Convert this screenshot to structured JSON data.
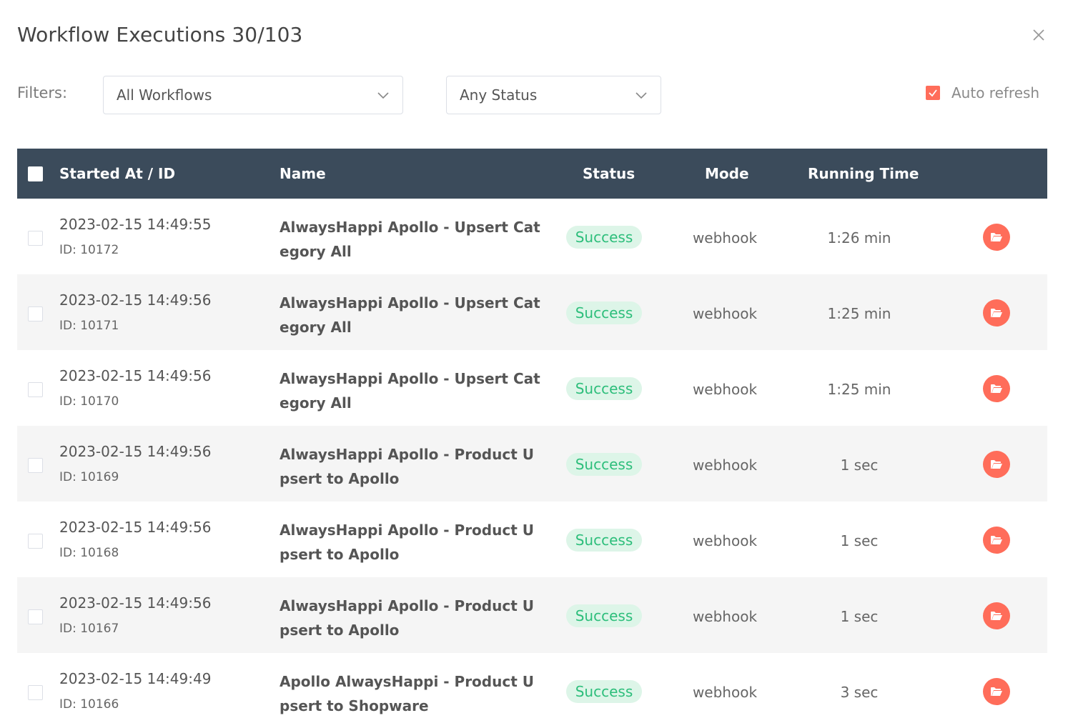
{
  "dialog": {
    "title": "Workflow Executions 30/103",
    "close_icon": "close-icon"
  },
  "filters": {
    "label": "Filters:",
    "workflow_select": "All Workflows",
    "status_select": "Any Status",
    "auto_refresh_label": "Auto refresh",
    "auto_refresh_checked": true
  },
  "table": {
    "headers": {
      "started": "Started At / ID",
      "name": "Name",
      "status": "Status",
      "mode": "Mode",
      "running_time": "Running Time"
    },
    "rows": [
      {
        "started": "2023-02-15 14:49:55",
        "id": "ID: 10172",
        "name": "AlwaysHappi Apollo - Upsert Category All",
        "status": "Success",
        "mode": "webhook",
        "running_time": "1:26 min"
      },
      {
        "started": "2023-02-15 14:49:56",
        "id": "ID: 10171",
        "name": "AlwaysHappi Apollo - Upsert Category All",
        "status": "Success",
        "mode": "webhook",
        "running_time": "1:25 min"
      },
      {
        "started": "2023-02-15 14:49:56",
        "id": "ID: 10170",
        "name": "AlwaysHappi Apollo - Upsert Category All",
        "status": "Success",
        "mode": "webhook",
        "running_time": "1:25 min"
      },
      {
        "started": "2023-02-15 14:49:56",
        "id": "ID: 10169",
        "name": "AlwaysHappi Apollo - Product Upsert to Apollo",
        "status": "Success",
        "mode": "webhook",
        "running_time": "1 sec"
      },
      {
        "started": "2023-02-15 14:49:56",
        "id": "ID: 10168",
        "name": "AlwaysHappi Apollo - Product Upsert to Apollo",
        "status": "Success",
        "mode": "webhook",
        "running_time": "1 sec"
      },
      {
        "started": "2023-02-15 14:49:56",
        "id": "ID: 10167",
        "name": "AlwaysHappi Apollo - Product Upsert to Apollo",
        "status": "Success",
        "mode": "webhook",
        "running_time": "1 sec"
      },
      {
        "started": "2023-02-15 14:49:49",
        "id": "ID: 10166",
        "name": "Apollo AlwaysHappi - Product Upsert to Shopware",
        "status": "Success",
        "mode": "webhook",
        "running_time": "3 sec"
      }
    ]
  },
  "colors": {
    "accent": "#ff6d5a",
    "header_bg": "#3b4b5b",
    "success_bg": "#ddf5e8",
    "success_text": "#2dbe7b"
  }
}
